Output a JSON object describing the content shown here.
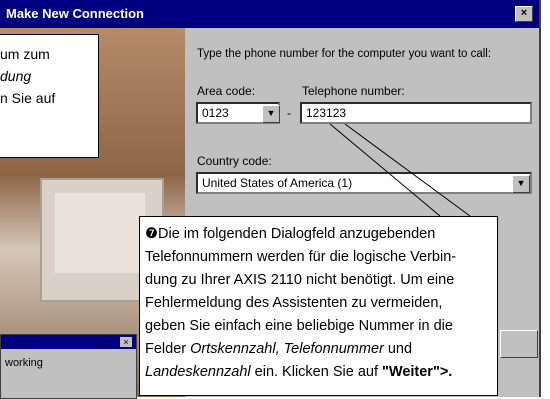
{
  "dialog": {
    "title": "Make New Connection",
    "close_glyph": "×",
    "instruction": "Type the phone number for the computer you want to call:",
    "area_code_label": "Area code:",
    "area_code_value": "0123",
    "dash": "-",
    "telephone_label": "Telephone number:",
    "telephone_value": "123123",
    "country_label": "Country code:",
    "country_value": "United States of America (1)",
    "dropdown_glyph": "▼"
  },
  "callout_top": {
    "line1": "um zum",
    "line2": "dung",
    "line3": "n Sie auf"
  },
  "callout_main": {
    "number_glyph": "❼",
    "line1": "Die im folgenden Dialogfeld anzugebenden",
    "line2": "Telefonnummern werden für die logische Verbin-",
    "line3": "dung zu Ihrer AXIS 2110 nicht benötigt. Um eine",
    "line4": "Fehlermeldung des Assistenten zu vermeiden,",
    "line5": "geben Sie einfach eine beliebige Nummer in die",
    "line6a": "Felder ",
    "line6b": "Ortskennzahl, Telefonnummer",
    "line6c": " und",
    "line7a": "Landeskennzahl",
    "line7b": " ein. Klicken Sie auf ",
    "line7c": "\"Weiter\">."
  },
  "mini_window": {
    "close_glyph": "×",
    "text": "working"
  }
}
